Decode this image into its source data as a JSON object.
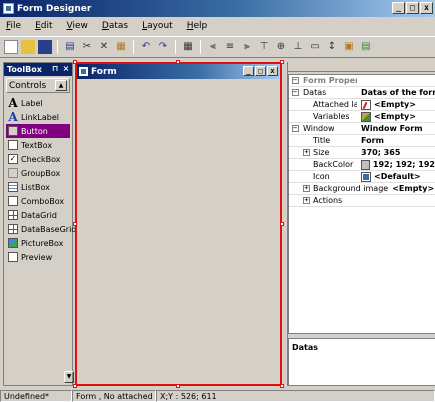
{
  "window": {
    "title": "Form Designer"
  },
  "menu": [
    {
      "label": "File"
    },
    {
      "label": "Edit"
    },
    {
      "label": "View"
    },
    {
      "label": "Datas"
    },
    {
      "label": "Layout"
    },
    {
      "label": "Help"
    }
  ],
  "toolbar": [
    "new-icon",
    "open-icon",
    "save-icon",
    "print-icon",
    "cut-icon",
    "copy-icon",
    "paste-icon",
    "undo-icon",
    "redo-icon",
    "grid-icon",
    "align-left-icon",
    "align-center-icon",
    "align-right-icon",
    "align-top-icon",
    "align-middle-icon",
    "align-bottom-icon",
    "same-size-icon",
    "tab-order-icon",
    "lock-icon",
    "tab-icon"
  ],
  "toolbox": {
    "title": "ToolBox",
    "section": "Controls",
    "items": [
      {
        "label": "Label",
        "icon": "label-icon"
      },
      {
        "label": "LinkLabel",
        "icon": "linklabel-icon"
      },
      {
        "label": "Button",
        "icon": "button-icon",
        "selected": true
      },
      {
        "label": "TextBox",
        "icon": "textbox-icon"
      },
      {
        "label": "CheckBox",
        "icon": "checkbox-icon"
      },
      {
        "label": "GroupBox",
        "icon": "groupbox-icon"
      },
      {
        "label": "ListBox",
        "icon": "listbox-icon"
      },
      {
        "label": "ComboBox",
        "icon": "combobox-icon"
      },
      {
        "label": "DataGrid",
        "icon": "datagrid-icon"
      },
      {
        "label": "DataBaseGrid",
        "icon": "databasegrid-icon"
      },
      {
        "label": "PictureBox",
        "icon": "picturebox-icon"
      },
      {
        "label": "Preview",
        "icon": "preview-icon"
      }
    ]
  },
  "form": {
    "title": "Form"
  },
  "properties": {
    "header": "Form Properties",
    "datas_label": "Datas",
    "datas_value": "Datas of the form",
    "attached_label": "Attached label",
    "attached_value": "<Empty>",
    "variables_label": "Variables",
    "variables_value": "<Empty>",
    "window_label": "Window",
    "window_value": "Window Form",
    "title_label": "Title",
    "title_value": "Form",
    "size_label": "Size",
    "size_value": "370; 365",
    "backcolor_label": "BackColor",
    "backcolor_value": "192; 192; 192",
    "backcolor_color": "#c0c0c0",
    "icon_label": "Icon",
    "icon_value": "<Default>",
    "bgimage_label": "Background image",
    "bgimage_value": "<Empty>",
    "actions_label": "Actions",
    "description": "Datas"
  },
  "status": {
    "cell1": "Undefined*",
    "cell2": "Form , No attached label",
    "cell3": "X;Y : 526; 611"
  }
}
